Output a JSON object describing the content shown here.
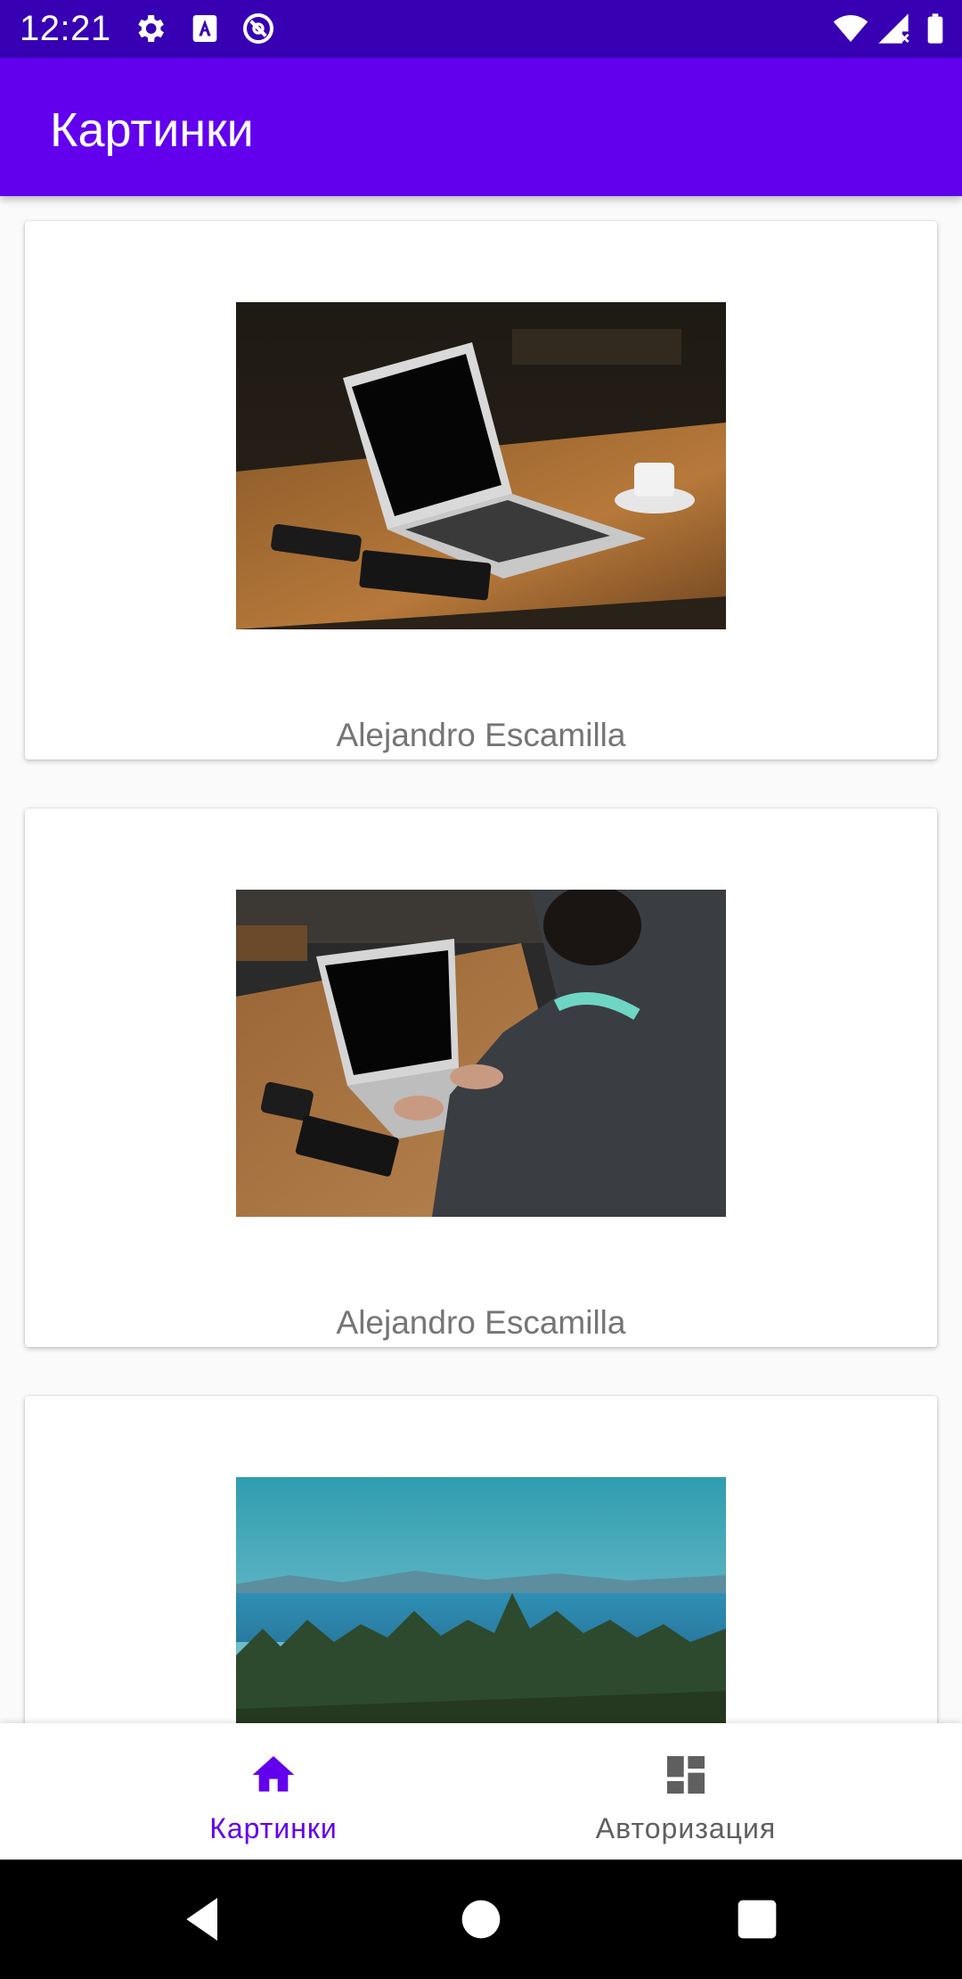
{
  "status_bar": {
    "time": "12:21",
    "left_icons": [
      "gear-icon",
      "font-a-icon",
      "at-sync-icon"
    ],
    "right_icons": [
      "wifi-icon",
      "signal-no-data-icon",
      "battery-icon"
    ],
    "background": "#3700b3"
  },
  "app_bar": {
    "title": "Картинки",
    "background": "#6200ee"
  },
  "cards": [
    {
      "author": "Alejandro Escamilla",
      "image": "laptop-on-wooden-table-photo"
    },
    {
      "author": "Alejandro Escamilla",
      "image": "person-typing-on-laptop-photo"
    },
    {
      "author": "",
      "image": "forest-and-sea-landscape-photo"
    }
  ],
  "bottom_nav": {
    "items": [
      {
        "label": "Картинки",
        "icon": "home-icon",
        "active": true
      },
      {
        "label": "Авторизация",
        "icon": "dashboard-icon",
        "active": false
      }
    ],
    "active_color": "#6200ee",
    "inactive_color": "#5f5f5f"
  },
  "system_nav": {
    "buttons": [
      "back-icon",
      "home-circle-icon",
      "recents-icon"
    ]
  }
}
